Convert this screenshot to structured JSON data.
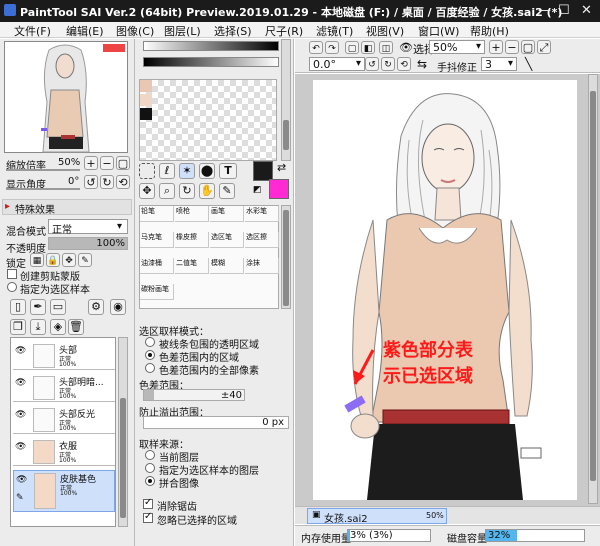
{
  "window": {
    "title": "PaintTool SAI Ver.2 (64bit) Preview.2019.01.29 - 本地磁盘 (F:) / 桌面 / 百度经验 / 女孩.sai2 (*)",
    "min": "—",
    "max": "☐",
    "close": "✕"
  },
  "menu": [
    "文件(F)",
    "编辑(E)",
    "图像(C)",
    "图层(L)",
    "选择(S)",
    "尺子(R)",
    "滤镜(T)",
    "视图(V)",
    "窗口(W)",
    "帮助(H)"
  ],
  "navigator": {
    "zoom_label": "缩放倍率",
    "zoom_value": "50%",
    "angle_label": "显示角度",
    "angle_value": "0°"
  },
  "effects": {
    "header": "特殊效果"
  },
  "layer_props": {
    "blend_label": "混合模式",
    "blend_value": "正常",
    "opacity_label": "不透明度",
    "opacity_value": "100%",
    "opacity_level": 1.0,
    "lock_label": "锁定",
    "clip_label": "创建剪贴蒙版",
    "sample_label": "指定为选区样本"
  },
  "layers": [
    {
      "name": "头部",
      "mode": "正常",
      "opacity": "100%"
    },
    {
      "name": "头部明暗...",
      "mode": "正常",
      "opacity": "100%"
    },
    {
      "name": "头部反光",
      "mode": "正常",
      "opacity": "100%"
    },
    {
      "name": "衣服",
      "mode": "正常",
      "opacity": "100%"
    },
    {
      "name": "皮肤基色",
      "mode": "正常",
      "opacity": "100%"
    }
  ],
  "tools": [
    "铅笔",
    "喷枪",
    "画笔",
    "水彩笔",
    "马克笔",
    "橡皮擦",
    "选区笔",
    "选区擦",
    "油漆桶",
    "二值笔",
    "模糊",
    "涂抹",
    "碳粉画笔"
  ],
  "colors": {
    "primary": "#1a1a1a",
    "secondary": "#ff2ad4"
  },
  "selection_options": {
    "header": "选区取样模式：",
    "opt1": "被线条包围的透明区域",
    "opt2": "色差范围内的区域",
    "opt3": "色差范围内的全部像素",
    "range_label": "色差范围：",
    "range_value": "±40",
    "overflow_label": "防止溢出范围：",
    "overflow_value": "0 px",
    "source_header": "取样来源：",
    "src1": "当前图层",
    "src2": "指定为选区样本的图层",
    "src3": "拼合图像",
    "aa_label": "消除锯齿",
    "ignore_label": "忽略已选择的区域"
  },
  "canvas_toolbar": {
    "select_label": "选择",
    "zoom_value": "50%",
    "angle_value": "0.0°",
    "stabilizer_label": "手抖修正",
    "stabilizer_value": "3"
  },
  "annotation": {
    "line1": "紫色部分表",
    "line2": "示已选区域",
    "color": "#ff1a1a"
  },
  "doc_tab": {
    "name": "女孩.sai2",
    "zoom": "50%"
  },
  "status": {
    "mem_label": "内存使用量",
    "mem_value": "3% (3%)",
    "mem_level": 0.03,
    "disk_label": "磁盘容量",
    "disk_value": "32%",
    "disk_level": 0.32
  }
}
